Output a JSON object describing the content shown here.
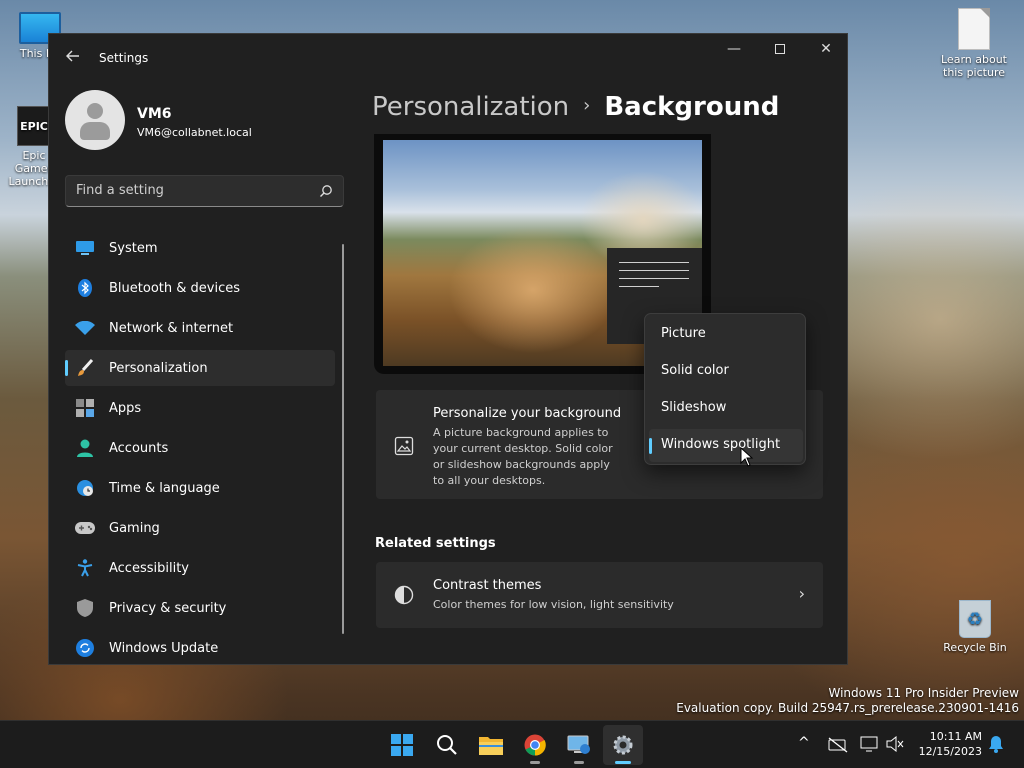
{
  "desktop": {
    "icons": [
      {
        "label": "This PC",
        "icon": "monitor-icon"
      },
      {
        "label": "Epic Games Launcher",
        "icon": "epic-games-icon"
      },
      {
        "label": "Learn about this picture",
        "icon": "file-icon"
      },
      {
        "label": "Recycle Bin",
        "icon": "recycle-bin-icon"
      }
    ],
    "watermark": {
      "line1": "Windows 11 Pro Insider Preview",
      "line2": "Evaluation copy. Build 25947.rs_prerelease.230901-1416"
    }
  },
  "window": {
    "title": "Settings",
    "controls": {
      "minimize": "—",
      "close": "✕"
    }
  },
  "profile": {
    "name": "VM6",
    "email": "VM6@collabnet.local"
  },
  "search": {
    "placeholder": "Find a setting"
  },
  "nav": {
    "items": [
      {
        "label": "System",
        "icon": "system-icon"
      },
      {
        "label": "Bluetooth & devices",
        "icon": "bluetooth-icon"
      },
      {
        "label": "Network & internet",
        "icon": "wifi-icon"
      },
      {
        "label": "Personalization",
        "icon": "brush-icon",
        "active": true
      },
      {
        "label": "Apps",
        "icon": "apps-icon"
      },
      {
        "label": "Accounts",
        "icon": "accounts-icon"
      },
      {
        "label": "Time & language",
        "icon": "globe-clock-icon"
      },
      {
        "label": "Gaming",
        "icon": "gamepad-icon"
      },
      {
        "label": "Accessibility",
        "icon": "accessibility-icon"
      },
      {
        "label": "Privacy & security",
        "icon": "shield-icon"
      },
      {
        "label": "Windows Update",
        "icon": "update-icon"
      }
    ]
  },
  "breadcrumb": {
    "parent": "Personalization",
    "separator": "›",
    "current": "Background"
  },
  "background_card": {
    "title": "Personalize your background",
    "description": "A picture background applies to your current desktop. Solid color or slideshow backgrounds apply to all your desktops."
  },
  "dropdown": {
    "options": [
      "Picture",
      "Solid color",
      "Slideshow",
      "Windows spotlight"
    ],
    "selected": "Windows spotlight"
  },
  "related": {
    "heading": "Related settings",
    "contrast": {
      "title": "Contrast themes",
      "description": "Color themes for low vision, light sensitivity"
    }
  },
  "taskbar": {
    "apps": [
      "windows-start-icon",
      "search-icon",
      "file-explorer-icon",
      "chrome-icon",
      "remote-desktop-icon",
      "settings-gear-icon"
    ],
    "clock": {
      "time": "10:11 AM",
      "date": "12/15/2023"
    },
    "chevron": "^"
  },
  "colors": {
    "accent": "#60cdff",
    "window_bg": "#202020",
    "card_bg": "#2b2b2b"
  }
}
